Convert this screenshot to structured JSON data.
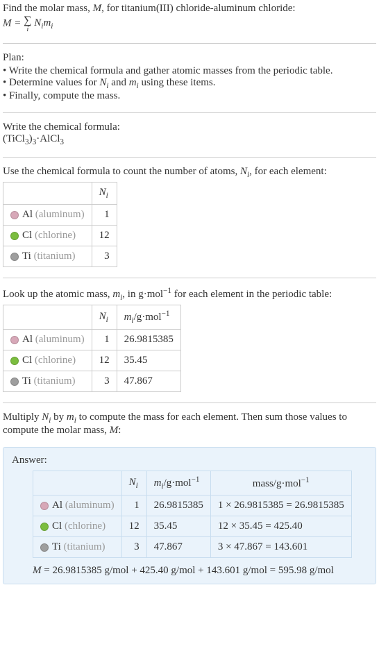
{
  "intro": {
    "line1": "Find the molar mass, ",
    "var_m": "M",
    "line1_after": ", for titanium(III) chloride-aluminum chloride:",
    "formula_lhs": "M = ",
    "sigma": "∑",
    "sigma_idx": "i",
    "formula_rhs_N": "N",
    "formula_rhs_m": "m"
  },
  "plan": {
    "title": "Plan:",
    "b1": "• Write the chemical formula and gather atomic masses from the periodic table.",
    "b2_pre": "• Determine values for ",
    "b2_n": "N",
    "b2_mid": " and ",
    "b2_m": "m",
    "b2_post": " using these items.",
    "b3": "• Finally, compute the mass."
  },
  "chem": {
    "title": "Write the chemical formula:",
    "p1": "(TiCl",
    "s1": "3",
    "p2": ")",
    "s2": "3",
    "p3": "·AlCl",
    "s3": "3"
  },
  "count": {
    "title_pre": "Use the chemical formula to count the number of atoms, ",
    "var_n": "N",
    "title_post": ", for each element:",
    "hdr_n": "N",
    "rows": [
      {
        "name": "Al",
        "label": "(aluminum)",
        "color": "#d7a8b8",
        "n": "1"
      },
      {
        "name": "Cl",
        "label": "(chlorine)",
        "color": "#7bbd3f",
        "n": "12"
      },
      {
        "name": "Ti",
        "label": "(titanium)",
        "color": "#9e9e9e",
        "n": "3"
      }
    ]
  },
  "lookup": {
    "title_pre": "Look up the atomic mass, ",
    "var_m": "m",
    "title_mid": ", in g·mol",
    "exp": "−1",
    "title_post": " for each element in the periodic table:",
    "hdr_n": "N",
    "hdr_m": "m",
    "hdr_m_unit": "/g·mol",
    "rows": [
      {
        "name": "Al",
        "label": "(aluminum)",
        "color": "#d7a8b8",
        "n": "1",
        "m": "26.9815385"
      },
      {
        "name": "Cl",
        "label": "(chlorine)",
        "color": "#7bbd3f",
        "n": "12",
        "m": "35.45"
      },
      {
        "name": "Ti",
        "label": "(titanium)",
        "color": "#9e9e9e",
        "n": "3",
        "m": "47.867"
      }
    ]
  },
  "multiply": {
    "line_pre": "Multiply ",
    "var_n": "N",
    "line_mid1": " by ",
    "var_m": "m",
    "line_mid2": " to compute the mass for each element. Then sum those values to compute the molar mass, ",
    "var_M": "M",
    "line_post": ":"
  },
  "answer": {
    "label": "Answer:",
    "hdr_n": "N",
    "hdr_m": "m",
    "hdr_m_unit": "/g·mol",
    "hdr_mass": "mass/g·mol",
    "exp": "−1",
    "rows": [
      {
        "name": "Al",
        "label": "(aluminum)",
        "color": "#d7a8b8",
        "n": "1",
        "m": "26.9815385",
        "mass": "1 × 26.9815385 = 26.9815385"
      },
      {
        "name": "Cl",
        "label": "(chlorine)",
        "color": "#7bbd3f",
        "n": "12",
        "m": "35.45",
        "mass": "12 × 35.45 = 425.40"
      },
      {
        "name": "Ti",
        "label": "(titanium)",
        "color": "#9e9e9e",
        "n": "3",
        "m": "47.867",
        "mass": "3 × 47.867 = 143.601"
      }
    ],
    "final_var": "M",
    "final_eq": " = 26.9815385 g/mol + 425.40 g/mol + 143.601 g/mol = 595.98 g/mol"
  }
}
